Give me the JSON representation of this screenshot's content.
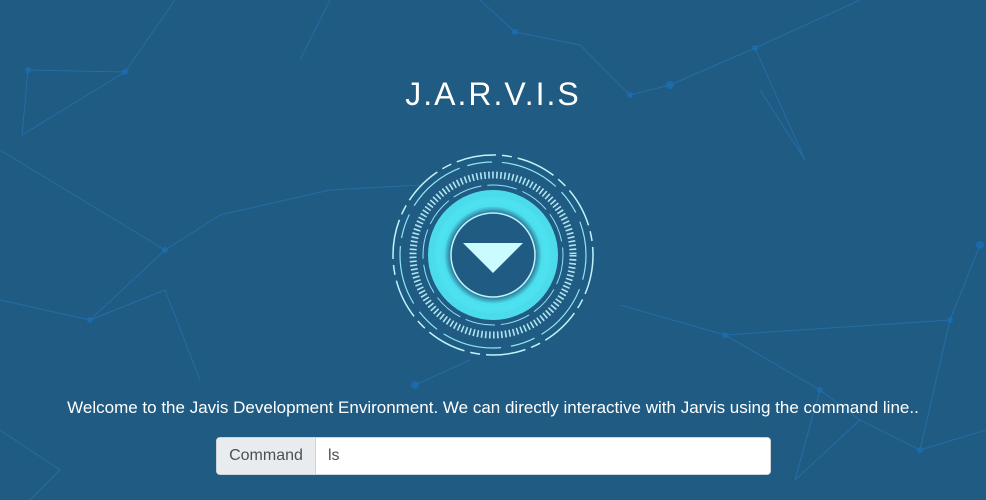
{
  "app": {
    "title": "J.A.R.V.I.S"
  },
  "welcome": {
    "message": "Welcome to the Javis Development Environment. We can directly interactive with Jarvis using the command line.."
  },
  "command": {
    "label": "Command",
    "value": "ls"
  },
  "icons": {
    "reactor": "arc-reactor-icon",
    "arrow": "triangle-down-icon"
  },
  "colors": {
    "background": "#1f5b82",
    "accent": "#4fe3f0",
    "net_lines": "#2f8fd6"
  }
}
